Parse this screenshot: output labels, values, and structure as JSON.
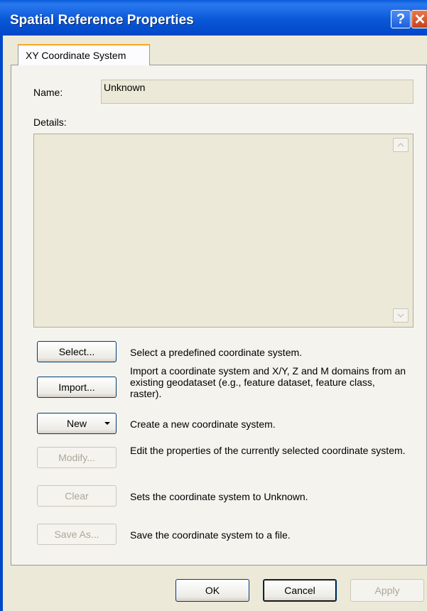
{
  "window": {
    "title": "Spatial Reference Properties",
    "help_glyph": "?",
    "close_glyph": "✕"
  },
  "tabs": [
    {
      "label": "XY Coordinate System"
    }
  ],
  "name": {
    "label": "Name:",
    "value": "Unknown"
  },
  "details": {
    "label": "Details:",
    "value": ""
  },
  "actions": [
    {
      "button": "Select...",
      "description": "Select a predefined coordinate system.",
      "enabled": true
    },
    {
      "button": "Import...",
      "description": "Import a coordinate system and X/Y, Z and M domains from an existing geodataset (e.g., feature dataset, feature class, raster).",
      "enabled": true
    },
    {
      "button": "New",
      "description": "Create a new coordinate system.",
      "enabled": true,
      "has_dropdown": true
    },
    {
      "button": "Modify...",
      "description": "Edit the properties of the currently selected coordinate system.",
      "enabled": false
    },
    {
      "button": "Clear",
      "description": "Sets the coordinate system to Unknown.",
      "enabled": false
    },
    {
      "button": "Save As...",
      "description": "Save the coordinate system to a file.",
      "enabled": false
    }
  ],
  "footer": {
    "ok": "OK",
    "cancel": "Cancel",
    "apply": "Apply"
  },
  "colors": {
    "titlebar": "#0a58d6",
    "dialog_bg": "#ece9d8",
    "disabled_text": "#aca899"
  },
  "icons": {
    "help": "help-icon",
    "close": "close-icon",
    "scroll_up": "scroll-up-arrow-icon",
    "scroll_down": "scroll-down-arrow-icon",
    "dropdown": "dropdown-arrow-icon"
  }
}
